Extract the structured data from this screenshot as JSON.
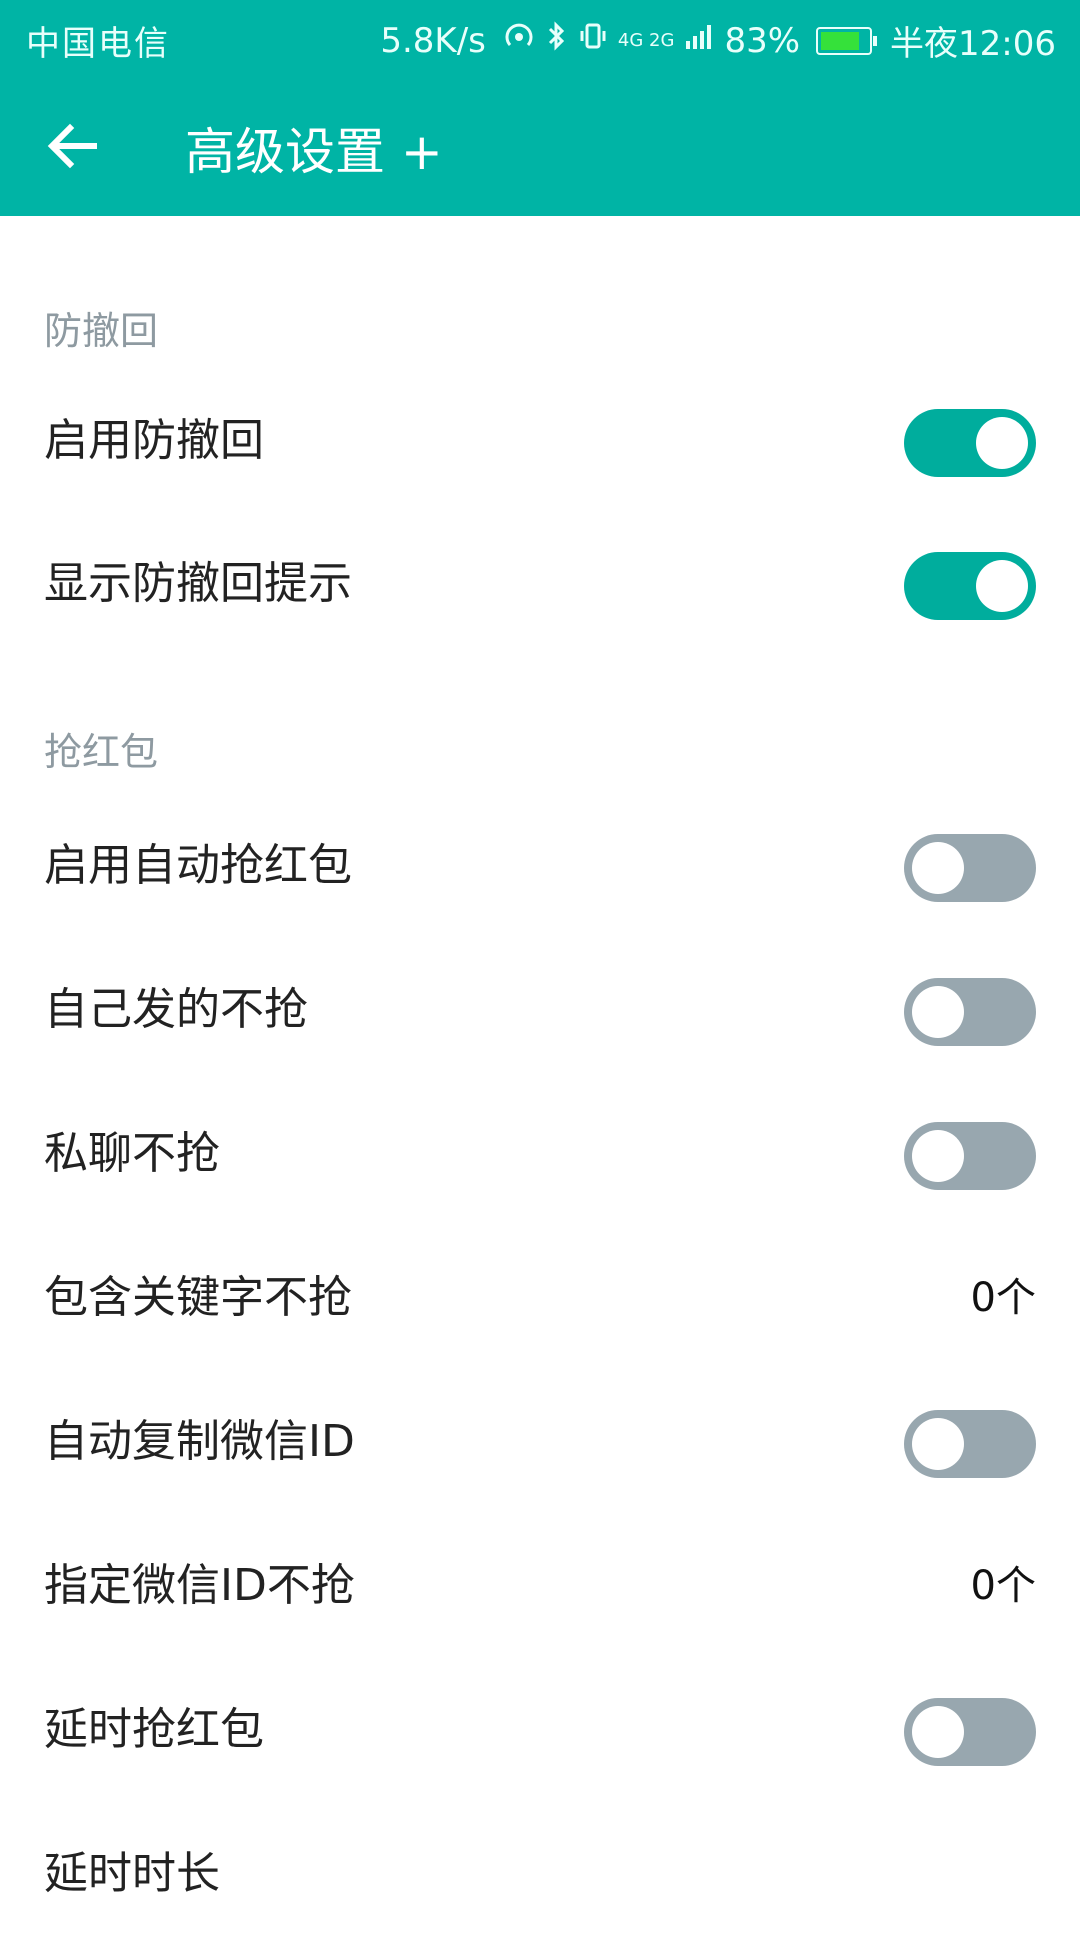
{
  "status_bar": {
    "carrier": "中国电信",
    "network_speed": "5.8K/s",
    "network_type": "4G 2G",
    "battery": "83%",
    "time": "半夜12:06",
    "icons": [
      "hotspot-icon",
      "bluetooth-icon",
      "vibrate-icon",
      "signal-icon",
      "battery-icon"
    ]
  },
  "app_bar": {
    "title": "高级设置 +",
    "back_icon": "arrow-left-icon"
  },
  "sections": {
    "recall": {
      "header": "防撤回",
      "items": [
        {
          "label": "启用防撤回",
          "enabled": true
        },
        {
          "label": "显示防撤回提示",
          "enabled": true
        }
      ]
    },
    "red_packet": {
      "header": "抢红包",
      "items": [
        {
          "label": "启用自动抢红包",
          "enabled": false
        },
        {
          "label": "自己发的不抢",
          "enabled": false
        },
        {
          "label": "私聊不抢",
          "enabled": false
        },
        {
          "label": "包含关键字不抢",
          "value": "0个"
        },
        {
          "label": "自动复制微信ID",
          "enabled": false
        },
        {
          "label": "指定微信ID不抢",
          "value": "0个"
        },
        {
          "label": "延时抢红包",
          "enabled": false
        },
        {
          "label": "延时时长"
        }
      ]
    }
  },
  "colors": {
    "primary": "#00b4a5",
    "switch_on": "#00ad9d",
    "switch_off": "#98a7af",
    "section_header": "#8e9aa1"
  }
}
